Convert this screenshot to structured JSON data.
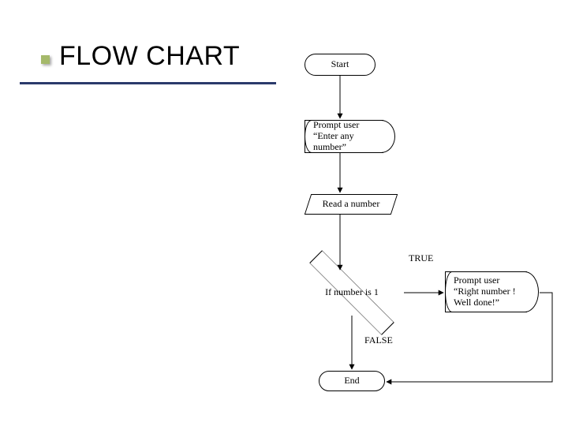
{
  "title": "FLOW CHART",
  "nodes": {
    "start": "Start",
    "prompt_enter": "Prompt user “Enter any number”",
    "read": "Read a number",
    "decision": "If number is 1",
    "prompt_done": "Prompt user “Right number ! Well done!”",
    "end": "End"
  },
  "labels": {
    "true": "TRUE",
    "false": "FALSE"
  },
  "chart_data": {
    "type": "flowchart",
    "title": "FLOW CHART",
    "nodes": [
      {
        "id": "start",
        "type": "terminator",
        "label": "Start"
      },
      {
        "id": "prompt_enter",
        "type": "display",
        "label": "Prompt user “Enter any number”"
      },
      {
        "id": "read",
        "type": "io",
        "label": "Read a number"
      },
      {
        "id": "decision",
        "type": "decision",
        "label": "If number is 1"
      },
      {
        "id": "prompt_done",
        "type": "display",
        "label": "Prompt user “Right number ! Well done!”"
      },
      {
        "id": "end",
        "type": "terminator",
        "label": "End"
      }
    ],
    "edges": [
      {
        "from": "start",
        "to": "prompt_enter"
      },
      {
        "from": "prompt_enter",
        "to": "read"
      },
      {
        "from": "read",
        "to": "decision"
      },
      {
        "from": "decision",
        "to": "prompt_done",
        "label": "TRUE"
      },
      {
        "from": "decision",
        "to": "end",
        "label": "FALSE"
      },
      {
        "from": "prompt_done",
        "to": "end"
      }
    ]
  }
}
